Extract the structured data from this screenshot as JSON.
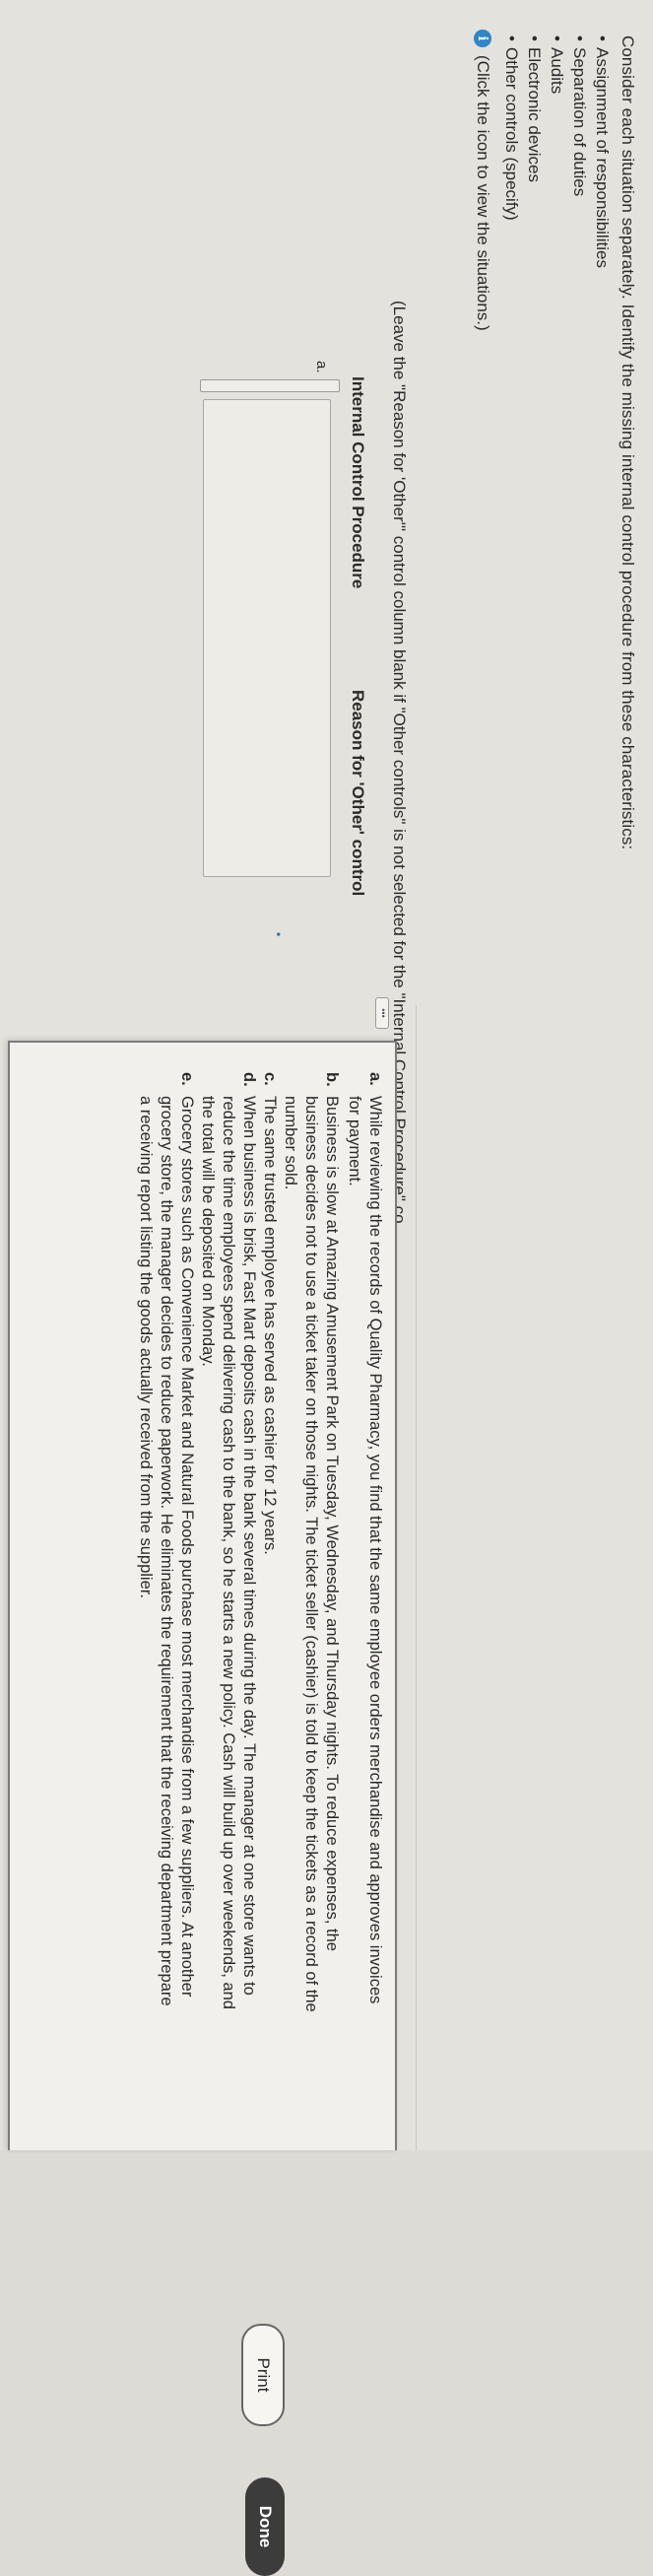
{
  "instructions": "Consider each situation separately. Identify the missing internal control procedure from these characteristics:",
  "characteristics": [
    "Assignment of responsibilities",
    "Separation of duties",
    "Audits",
    "Electronic devices",
    "Other controls (specify)"
  ],
  "info": {
    "icon": "info-icon",
    "text": "(Click the icon to view the situations.)"
  },
  "leave_note": "(Leave the \"Reason for 'Other'\" control column blank if \"Other controls\" is not selected for the \"Internal Control Procedure\" co",
  "table": {
    "header_procedure": "Internal Control Procedure",
    "header_reason": "Reason for 'Other' control",
    "rows": [
      {
        "label": "a.",
        "procedure": "",
        "reason": ""
      }
    ],
    "more_dots": "•"
  },
  "ellipsis_button": "•••",
  "dialog": {
    "situations": [
      {
        "letter": "a.",
        "text": "While reviewing the records of Quality Pharmacy, you find that the same employee orders merchandise and approves invoices for payment."
      },
      {
        "letter": "b.",
        "text": "Business is slow at Amazing Amusement Park on Tuesday, Wednesday, and Thursday nights. To reduce expenses, the business decides not to use a ticket taker on those nights. The ticket seller (cashier) is told to keep the tickets as a record of the number sold."
      },
      {
        "letter": "c.",
        "text": "The same trusted employee has served as cashier for 12 years."
      },
      {
        "letter": "d.",
        "text": "When business is brisk, Fast Mart deposits cash in the bank several times during the day. The manager at one store wants to reduce the time employees spend delivering cash to the bank, so he starts a new policy. Cash will build up over weekends, and the total will be deposited on Monday."
      },
      {
        "letter": "e.",
        "text": "Grocery stores such as Convenience Market and Natural Foods purchase most merchandise from a few suppliers. At another grocery store, the manager decides to reduce paperwork. He eliminates the requirement that the receiving department prepare a receiving report listing the goods actually received from the supplier."
      }
    ],
    "print_label": "Print",
    "done_label": "Done"
  },
  "colors": {
    "info_icon": "#2f86c9",
    "done_button": "#3c3c3c"
  }
}
